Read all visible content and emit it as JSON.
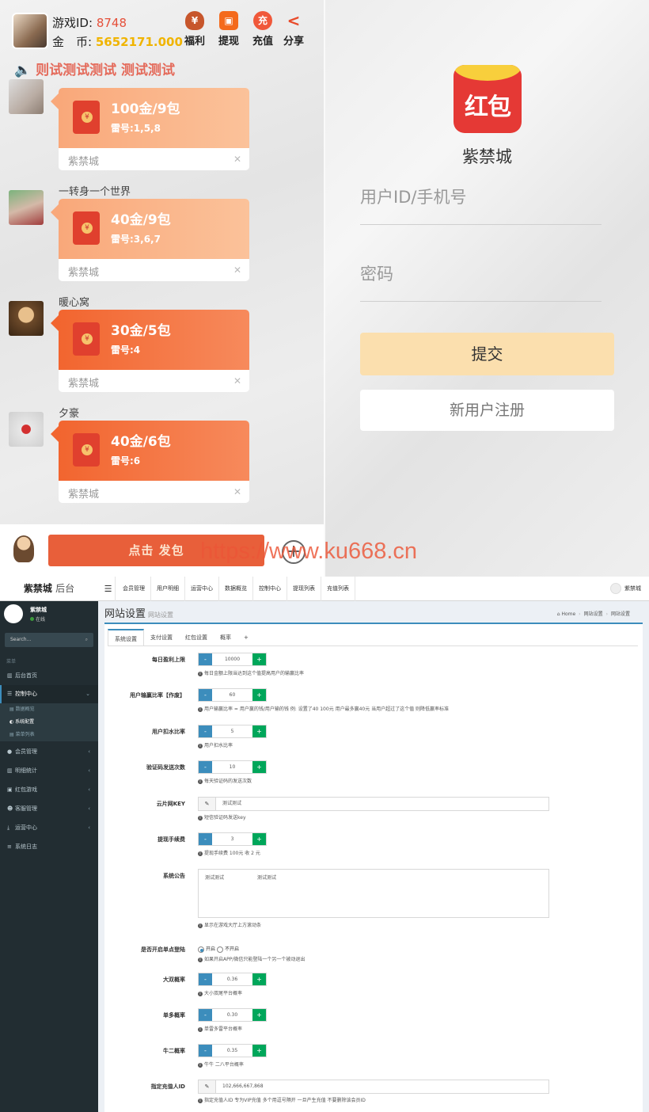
{
  "mobile": {
    "header": {
      "id_label": "游戏ID:",
      "id_value": "8748",
      "coin_label": "金　币:",
      "coin_value": "5652171.000",
      "buttons": [
        {
          "label": "福利",
          "icon": "money-bag-icon"
        },
        {
          "label": "提现",
          "icon": "withdraw-icon"
        },
        {
          "label": "充值",
          "icon": "recharge-icon"
        },
        {
          "label": "分享",
          "icon": "share-icon"
        }
      ]
    },
    "marquee": "🔈 则试测试测试 测试测试",
    "messages": [
      {
        "name": "",
        "amount": "100金/9包",
        "leihao": "雷号:1,5,8",
        "brand": "紫禁城"
      },
      {
        "name": "一转身一个世界",
        "amount": "40金/9包",
        "leihao": "雷号:3,6,7",
        "brand": "紫禁城"
      },
      {
        "name": "暖心窝",
        "amount": "30金/5包",
        "leihao": "雷号:4",
        "brand": "紫禁城"
      },
      {
        "name": "夕豪",
        "amount": "40金/6包",
        "leihao": "雷号:6",
        "brand": "紫禁城"
      }
    ],
    "send_button": "点击 发包",
    "watermark": "https://www.ku668.cn"
  },
  "login": {
    "app_icon_text": "红包",
    "app_name": "紫禁城",
    "user_placeholder": "用户ID/手机号",
    "password_placeholder": "密码",
    "submit": "提交",
    "register": "新用户注册"
  },
  "admin": {
    "logo": "紫禁城",
    "logo_suffix": "后台",
    "nav": [
      "会员管理",
      "用户明细",
      "运营中心",
      "数据概览",
      "控制中心",
      "提现列表",
      "充值列表"
    ],
    "user": "紫禁城",
    "sidebar": {
      "user_name": "紫禁城",
      "status": "在线",
      "search_placeholder": "Search...",
      "heading": "菜单",
      "items": [
        {
          "label": "后台首页"
        },
        {
          "label": "控制中心"
        },
        {
          "label": "会员管理"
        },
        {
          "label": "明细统计"
        },
        {
          "label": "红包游戏"
        },
        {
          "label": "客服管理"
        },
        {
          "label": "运营中心"
        },
        {
          "label": "系统日志"
        }
      ],
      "sub_items": [
        "数据概览",
        "系统配置",
        "菜单列表"
      ]
    },
    "page_title": "网站设置",
    "page_subtitle": "网站设置",
    "breadcrumb": [
      "Home",
      "网站设置",
      "网站设置"
    ],
    "tabs": [
      "系统设置",
      "支付设置",
      "红包设置",
      "概率",
      "+"
    ],
    "fields": [
      {
        "label": "每日盈利上限",
        "value": "10000",
        "help": "每日金额上限当达到这个值提高用户的输赢比率"
      },
      {
        "label": "用户输赢比率【作废】",
        "value": "60",
        "help": "用户输赢比率 = 用户赢的钱/用户输的钱 例: 设置了40 100元 用户最多赢40元 当用户超过了这个值 则降低赢率标准"
      },
      {
        "label": "用户扣水比率",
        "value": "5",
        "help": "用户扣水比率"
      },
      {
        "label": "验证码发送次数",
        "value": "10",
        "help": "每天验证码的发送次数"
      },
      {
        "label": "云片网KEY",
        "value": "测试测试",
        "help": "短信验证码发送key"
      },
      {
        "label": "提现手续费",
        "value": "3",
        "help": "提现手续费 100元 收 2 元"
      },
      {
        "label": "系统公告",
        "value": "测试测试　　　　　　　测试测试",
        "help": "显示在游戏大厅上方滚动条"
      },
      {
        "label": "是否开启单点登陆",
        "opt_on": "开启",
        "opt_off": "不开启",
        "help": "如果开启APP/微信只能登陆一个另一个被动退出"
      },
      {
        "label": "大双概率",
        "value": "0.36",
        "help": "大小双尾平台概率"
      },
      {
        "label": "单多概率",
        "value": "0.30",
        "help": "单雷多雷平台概率"
      },
      {
        "label": "牛二概率",
        "value": "0.35",
        "help": "牛牛 二八平台概率"
      },
      {
        "label": "指定充值人ID",
        "value": "102,666,667,868",
        "help": "指定充值人ID 专为VIP充值 多个用逗号隔开 一旦产生充值 不要删除该会员ID"
      }
    ]
  }
}
